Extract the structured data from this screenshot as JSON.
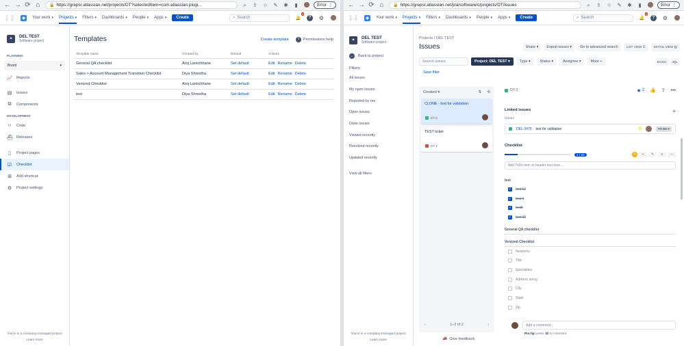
{
  "left": {
    "browser": {
      "url": "https://grepsr.atlassian.net/projects/DT?selectedItem=com.atlassian.plugi...",
      "error": "Error"
    },
    "topnav": {
      "your_work": "Your work",
      "projects": "Projects",
      "filters": "Filters",
      "dashboards": "Dashboards",
      "people": "People",
      "apps": "Apps",
      "create": "Create",
      "search": "Search",
      "badge": "3"
    },
    "sidebar": {
      "project_name": "DEL TEST",
      "project_type": "Software project",
      "planning": "PLANNING",
      "board": "Board",
      "items_planning": [
        {
          "label": "Reports"
        },
        {
          "label": "Issues"
        },
        {
          "label": "Components"
        }
      ],
      "development": "DEVELOPMENT",
      "items_dev": [
        {
          "label": "Code"
        },
        {
          "label": "Releases"
        }
      ],
      "items_bottom": [
        {
          "label": "Project pages"
        },
        {
          "label": "Checklist"
        },
        {
          "label": "Add shortcut"
        },
        {
          "label": "Project settings"
        }
      ],
      "footer_line1": "You're in a company-managed project",
      "footer_line2": "Learn more"
    },
    "main": {
      "title": "Templates",
      "create_template": "Create template",
      "permissions_help": "Permissions help",
      "columns": [
        "Template name",
        "Created by",
        "Default",
        "Actions"
      ],
      "rows": [
        {
          "name": "General QA checklist",
          "by": "Aroj Lamichhane",
          "default": "Set default",
          "edit": "Edit",
          "rename": "Rename",
          "delete": "Delete"
        },
        {
          "name": "Sales > Account Management Transition Checklist",
          "by": "Diya Shrestha",
          "default": "Set default",
          "edit": "Edit",
          "rename": "Rename",
          "delete": "Delete"
        },
        {
          "name": "Vericred Checklist",
          "by": "Aroj Lamichhane",
          "default": "Set default",
          "edit": "Edit",
          "rename": "Rename",
          "delete": "Delete"
        },
        {
          "name": "test",
          "by": "Diya Shrestha",
          "default": "Set default",
          "edit": "Edit",
          "rename": "Rename",
          "delete": "Delete"
        }
      ]
    }
  },
  "right": {
    "browser": {
      "url": "https://grepsr.atlassian.net/jira/software/c/projects/DT/issues",
      "error": "Error"
    },
    "topnav": {
      "your_work": "Your work",
      "projects": "Projects",
      "filters": "Filters",
      "dashboards": "Dashboards",
      "people": "People",
      "apps": "Apps",
      "create": "Create",
      "search": "Search",
      "badge": "3"
    },
    "sidebar": {
      "project_name": "DEL TEST",
      "project_type": "Software project",
      "back": "Back to project",
      "filters_heading": "Filters",
      "filters": [
        "All issues",
        "My open issues",
        "Reported by me",
        "Open issues",
        "Done issues",
        "Viewed recently",
        "Resolved recently",
        "Updated recently"
      ],
      "view_all": "View all filters",
      "footer_line1": "You're in a company-managed project",
      "footer_line2": "Learn more"
    },
    "main": {
      "breadcrumb_projects": "Projects",
      "breadcrumb_sep": "/",
      "breadcrumb_project": "DEL TEST",
      "title": "Issues",
      "share": "Share",
      "export": "Export issues",
      "advanced": "Go to advanced search",
      "list_view": "LIST VIEW",
      "detail_view": "DETAIL VIEW",
      "search_placeholder": "Search issues",
      "project_filter": "Project: DEL TEST",
      "type": "Type",
      "status": "Status",
      "assignee": "Assignee",
      "more": "More",
      "basic": "BASIC",
      "jql": "JQL",
      "save_filter": "Save filter",
      "list": {
        "sort": "Created",
        "cards": [
          {
            "title": "CLONE - test for validation",
            "key": "DT-2"
          },
          {
            "title": "TEST ticket",
            "key": "DT-1"
          }
        ],
        "pager": "1–2 of 2"
      },
      "give_feedback": "Give feedback",
      "detail": {
        "key": "DT-2",
        "watchers": "2",
        "linked_issues": "Linked issues",
        "clones": "clones",
        "linked": {
          "key": "DEL-3475",
          "title": "test for validation",
          "status": "TO DO"
        },
        "checklist": "Checklist",
        "progress_label": "4 / 20",
        "progress": 0.2,
        "progress_alert": "A",
        "add_placeholder": "Add ToDo item or header text here...",
        "group_test": "test",
        "test_items": [
          {
            "label": "test 12",
            "checked": true
          },
          {
            "label": "test 2",
            "checked": true
          },
          {
            "label": "test5",
            "checked": true
          },
          {
            "label": "test 33",
            "checked": true
          }
        ],
        "group_general": "General QA checklist",
        "group_vericred": "Vericred Checklist",
        "vericred_items": [
          "Networks",
          "Title",
          "Specialties",
          "Address string",
          "City",
          "State",
          "Zip"
        ]
      },
      "comment_placeholder": "Add a comment...",
      "protip_label": "Pro tip:",
      "protip_press": "press",
      "protip_key": "M",
      "protip_rest": "to comment"
    }
  },
  "colors": {
    "accent": "#0052cc",
    "nav_dark": "#253858",
    "create_blue": "#0052cc"
  }
}
